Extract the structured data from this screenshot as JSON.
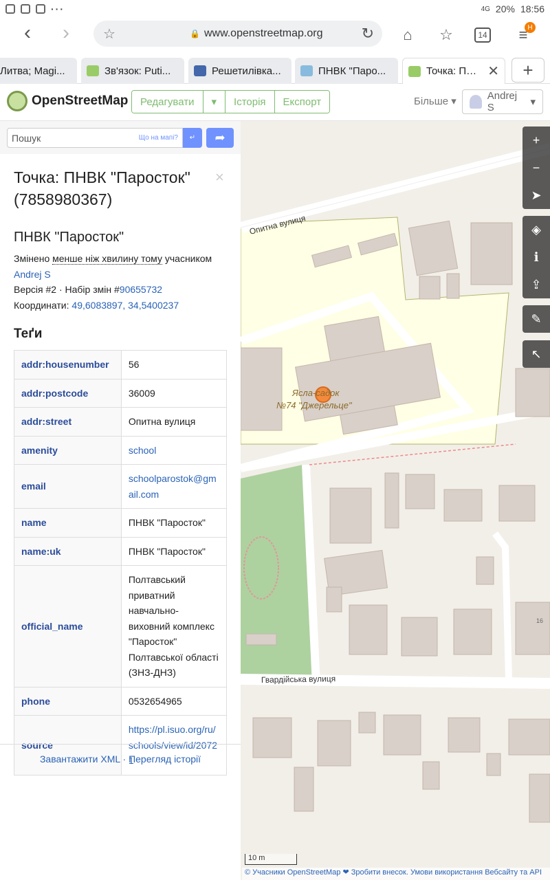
{
  "status": {
    "battery": "20%",
    "time": "18:56",
    "signal": "4G"
  },
  "browser": {
    "url": "www.openstreetmap.org",
    "tab_count": "14",
    "menu_badge": "H"
  },
  "tabs": [
    {
      "label": "Литва; Magi..."
    },
    {
      "label": "Зв'язок: Puti..."
    },
    {
      "label": "Решетилівка..."
    },
    {
      "label": "ПНВК \"Паро..."
    },
    {
      "label": "Точка: ПН..."
    }
  ],
  "osm": {
    "logo": "OpenStreetMap",
    "edit": "Редагувати",
    "history": "Історія",
    "export": "Експорт",
    "more": "Більше",
    "user": "Andrej S"
  },
  "search": {
    "placeholder": "Пошук",
    "where": "Що на мапі?",
    "go": "↵"
  },
  "feature": {
    "title": "Точка: ПНВК \"Паросток\" (7858980367)",
    "subtitle": "ПНВК \"Паросток\"",
    "changed_prefix": "Змінено",
    "changed_when": "менше ніж хвилину тому",
    "changed_by": "учасником",
    "user": "Andrej S",
    "version": "Версія #2 · Набір змін #",
    "changeset": "90655732",
    "coords_label": "Координати:",
    "coords": "49,6083897, 34,5400237",
    "tags_heading": "Теґи",
    "tags": [
      {
        "k": "addr:housenumber",
        "v": "56"
      },
      {
        "k": "addr:postcode",
        "v": "36009"
      },
      {
        "k": "addr:street",
        "v": "Опитна вулиця"
      },
      {
        "k": "amenity",
        "v": "school"
      },
      {
        "k": "email",
        "v": "schoolparostok@gmail.com"
      },
      {
        "k": "name",
        "v": "ПНВК \"Паросток\""
      },
      {
        "k": "name:uk",
        "v": "ПНВК \"Паросток\""
      },
      {
        "k": "official_name",
        "v": "Полтавський приватний навчально-виховний комплекс \"Паросток\" Полтавської області (ЗНЗ-ДНЗ)"
      },
      {
        "k": "phone",
        "v": "0532654965"
      },
      {
        "k": "source",
        "v": "https://pl.isuo.org/ru/schools/view/id/20721"
      }
    ],
    "footer": "Завантажити XML · Перегляд історії"
  },
  "map": {
    "street1": "Опитна вулиця",
    "street2": "Гвардійська вулиця",
    "poi1": "Ясла-садок",
    "poi2": "№74 \"Джерельце\"",
    "house": "16",
    "scale": "10 m",
    "attribution": "© Учасники OpenStreetMap ❤ Зробити внесок. Умови використання Вебсайту та API"
  }
}
